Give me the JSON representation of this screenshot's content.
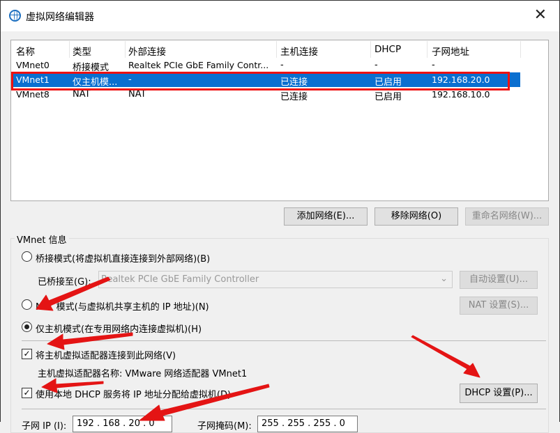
{
  "title": "虚拟网络编辑器",
  "columns": [
    "名称",
    "类型",
    "外部连接",
    "主机连接",
    "DHCP",
    "子网地址"
  ],
  "rows": [
    [
      "VMnet0",
      "桥接模式",
      "Realtek PCIe GbE Family Contr...",
      "-",
      "-",
      "-"
    ],
    [
      "VMnet1",
      "仅主机模...",
      "-",
      "已连接",
      "已启用",
      "192.168.20.0"
    ],
    [
      "VMnet8",
      "NAT",
      "NAT",
      "已连接",
      "已启用",
      "192.168.10.0"
    ]
  ],
  "buttons": {
    "add": "添加网络(E)...",
    "remove": "移除网络(O)",
    "rename": "重命名网络(W)..."
  },
  "info": {
    "group_label": "VMnet 信息",
    "bridge": "桥接模式(将虚拟机直接连接到外部网络)(B)",
    "bridged_to_label": "已桥接至(G):",
    "bridged_to_value": "Realtek PCIe GbE Family Controller",
    "auto": "自动设置(U)...",
    "nat": "NAT 模式(与虚拟机共享主机的 IP 地址)(N)",
    "nat_settings": "NAT 设置(S)...",
    "hostonly": "仅主机模式(在专用网络内连接虚拟机)(H)",
    "connect_adapter": "将主机虚拟适配器连接到此网络(V)",
    "adapter_name": "主机虚拟适配器名称: VMware 网络适配器 VMnet1",
    "use_dhcp": "使用本地 DHCP 服务将 IP 地址分配给虚拟机(D)",
    "dhcp_settings": "DHCP 设置(P)...",
    "subnet_ip_label": "子网 IP (I):",
    "subnet_ip": "192 . 168 . 20 . 0",
    "mask_label": "子网掩码(M):",
    "mask": "255 . 255 . 255 . 0"
  }
}
